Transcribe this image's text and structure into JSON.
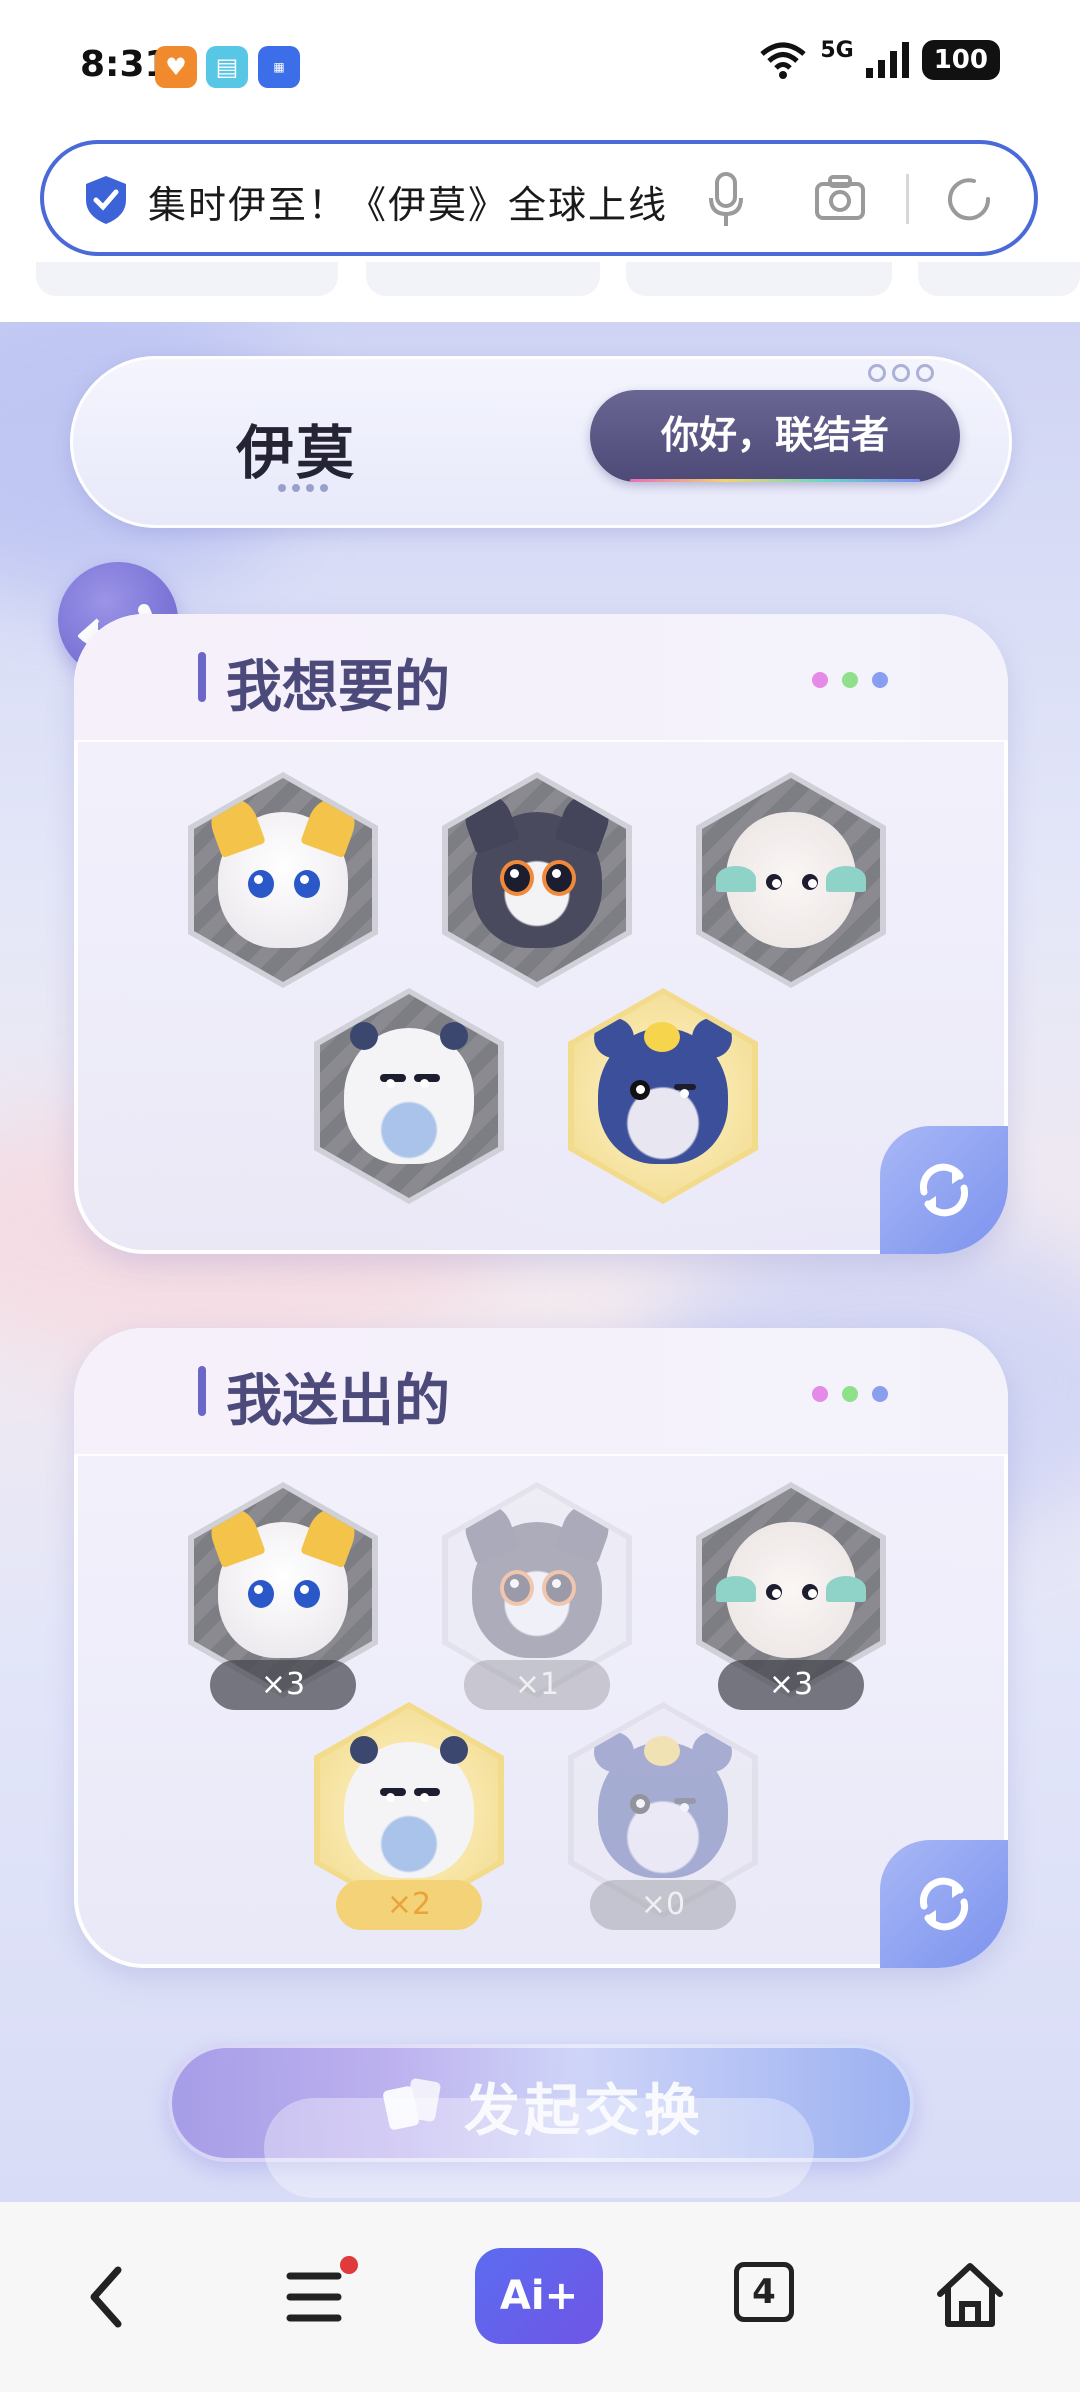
{
  "status_bar": {
    "time": "8:31",
    "network": "5G",
    "battery": "100",
    "app_icons": [
      "health-app-icon",
      "reader-app-icon",
      "app-market-icon"
    ]
  },
  "search": {
    "text": "集时伊至！《伊莫》全球上线"
  },
  "header": {
    "logo": "伊莫",
    "greeting": "你好，联结者"
  },
  "want_panel": {
    "title": "我想要的",
    "creatures": [
      "yellow-fox",
      "dark-fox",
      "fluffy-sheep",
      "white-seal",
      "blue-squirrel"
    ]
  },
  "give_panel": {
    "title": "我送出的",
    "items": [
      {
        "creature": "yellow-fox",
        "count": "×3"
      },
      {
        "creature": "dark-fox",
        "count": "×1"
      },
      {
        "creature": "fluffy-sheep",
        "count": "×3"
      },
      {
        "creature": "white-seal",
        "count": "×2"
      },
      {
        "creature": "blue-squirrel",
        "count": "×0"
      }
    ]
  },
  "exchange_button": "发起交换",
  "bottom_nav": {
    "tab_count": "4",
    "ai_label": "Ai+"
  },
  "colors": {
    "accent": "#4a6ad8",
    "title": "#4b4a7a",
    "dot_pink": "#e58ae6",
    "dot_green": "#8ee08a",
    "dot_blue": "#8a9ef0"
  }
}
